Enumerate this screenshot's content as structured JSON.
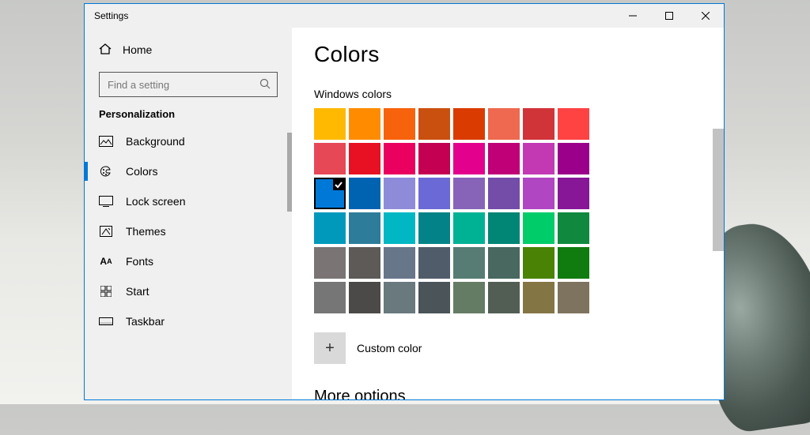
{
  "window": {
    "title": "Settings"
  },
  "sidebar": {
    "home": "Home",
    "search_placeholder": "Find a setting",
    "section": "Personalization",
    "items": [
      {
        "label": "Background",
        "icon": "background-icon",
        "selected": false
      },
      {
        "label": "Colors",
        "icon": "colors-icon",
        "selected": true
      },
      {
        "label": "Lock screen",
        "icon": "lockscreen-icon",
        "selected": false
      },
      {
        "label": "Themes",
        "icon": "themes-icon",
        "selected": false
      },
      {
        "label": "Fonts",
        "icon": "fonts-icon",
        "selected": false
      },
      {
        "label": "Start",
        "icon": "start-icon",
        "selected": false
      },
      {
        "label": "Taskbar",
        "icon": "taskbar-icon",
        "selected": false
      }
    ]
  },
  "content": {
    "heading": "Colors",
    "windows_colors_label": "Windows colors",
    "custom_color_label": "Custom color",
    "more_options_label": "More options",
    "selected_index": 16,
    "swatches": [
      "#ffb900",
      "#ff8c00",
      "#f7630c",
      "#ca5010",
      "#da3b01",
      "#ef6950",
      "#d13438",
      "#ff4343",
      "#e74856",
      "#e81123",
      "#ea005e",
      "#c30052",
      "#e3008c",
      "#bf0077",
      "#c239b3",
      "#9a0089",
      "#0078d7",
      "#0063b1",
      "#8e8cd8",
      "#6b69d6",
      "#8764b8",
      "#744da9",
      "#b146c2",
      "#881798",
      "#0099bc",
      "#2d7d9a",
      "#00b7c3",
      "#038387",
      "#00b294",
      "#018574",
      "#00cc6a",
      "#10893e",
      "#7a7574",
      "#5d5a58",
      "#68768a",
      "#515c6b",
      "#567c73",
      "#486860",
      "#498205",
      "#107c10",
      "#767676",
      "#4c4a48",
      "#69797e",
      "#4a5459",
      "#647c64",
      "#525e54",
      "#847545",
      "#7e735f"
    ]
  }
}
